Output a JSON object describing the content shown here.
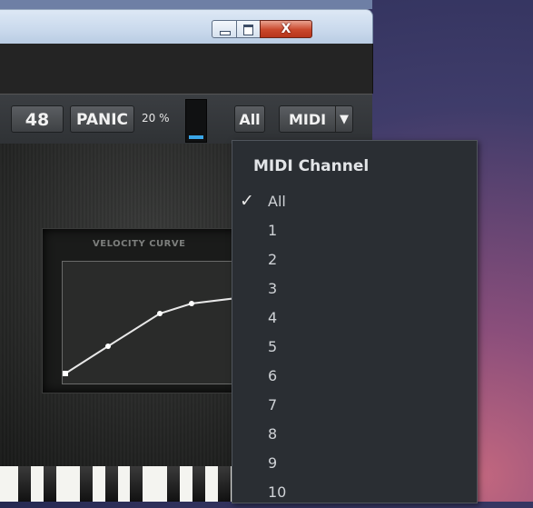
{
  "window": {
    "minimize_icon": "minimize-icon",
    "maximize_icon": "maximize-icon",
    "close_label": "X"
  },
  "toolbar": {
    "number_value": "48",
    "panic_label": "PANIC",
    "cpu_percent": "20 %",
    "cpu_meter_level": 0.1,
    "all_label": "All",
    "midi_label": "MIDI",
    "midi_arrow": "▼"
  },
  "velocity_curve": {
    "title": "VELOCITY CURVE"
  },
  "midi_menu": {
    "header": "MIDI Channel",
    "selected": "All",
    "check_glyph": "✓",
    "items": [
      "All",
      "1",
      "2",
      "3",
      "4",
      "5",
      "6",
      "7",
      "8",
      "9",
      "10"
    ]
  },
  "colors": {
    "meter_fill": "#3aa6e8",
    "menu_bg": "#2a2e33",
    "close_button": "#c9472b"
  }
}
